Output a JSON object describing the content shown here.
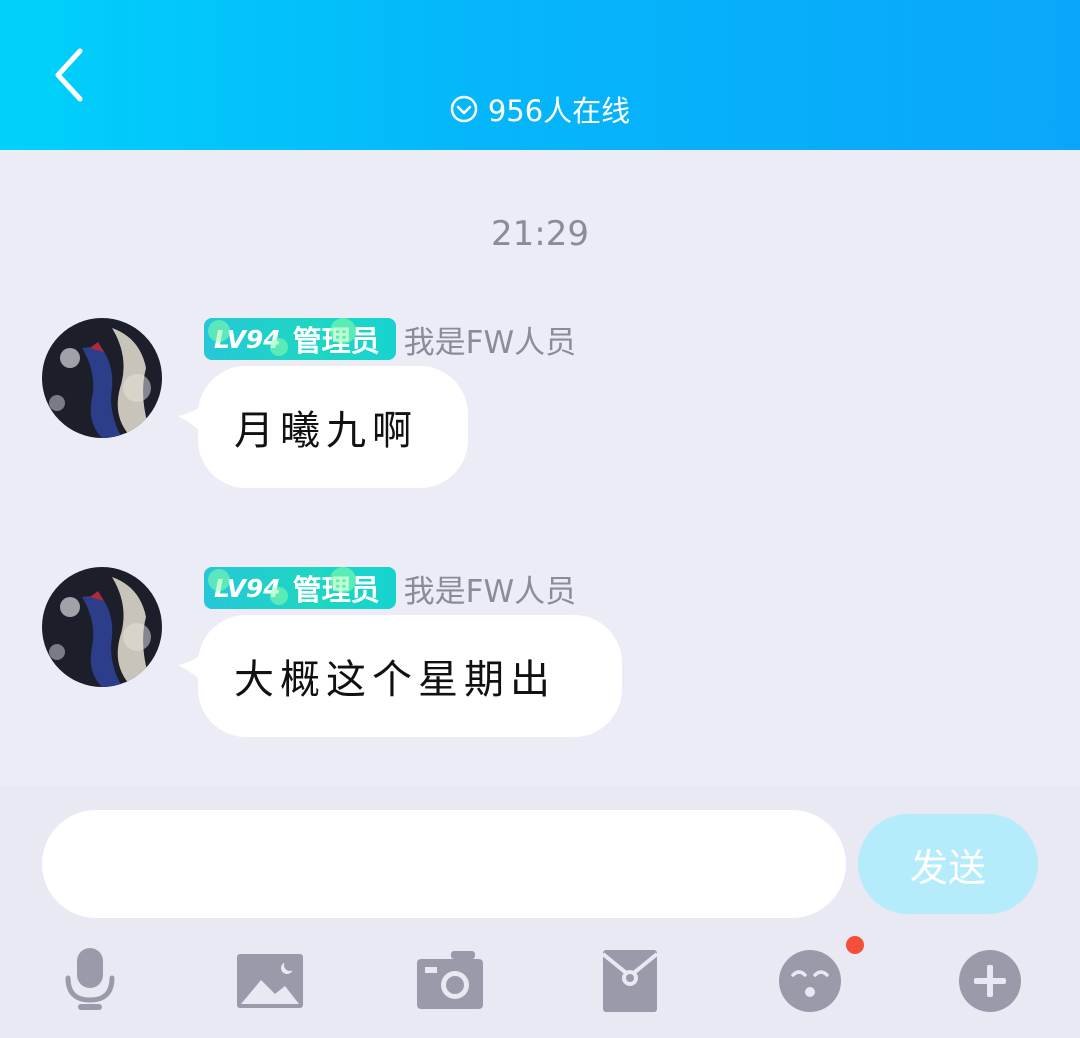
{
  "header": {
    "back_icon": "chevron-left-icon",
    "online_icon": "chevron-down-circle-icon",
    "online_text": "956人在线",
    "color_start": "#00d1fb",
    "color_end": "#0aa6fb"
  },
  "chat": {
    "timestamp": "21:29",
    "messages": [
      {
        "level": "LV94",
        "role": "管理员",
        "sender": "我是FW人员",
        "text": "月曦九啊"
      },
      {
        "level": "LV94",
        "role": "管理员",
        "sender": "我是FW人员",
        "text": "大概这个星期出"
      }
    ]
  },
  "composer": {
    "input_value": "",
    "send_label": "发送",
    "send_color": "#b5ecfb"
  },
  "toolbar": {
    "items": [
      "microphone-icon",
      "image-icon",
      "camera-icon",
      "red-packet-icon",
      "emoji-icon",
      "plus-icon"
    ],
    "notification_color": "#f2503b"
  }
}
